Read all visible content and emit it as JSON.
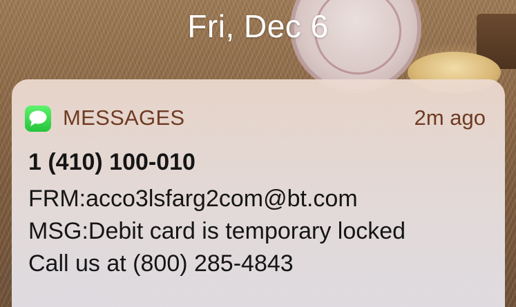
{
  "lock_screen": {
    "date": "Fri, Dec 6"
  },
  "notification": {
    "app_name": "MESSAGES",
    "app_icon": "messages-bubble-icon",
    "timestamp": "2m ago",
    "sender": "1 (410) 100-010",
    "body_lines": [
      "FRM:acco3lsfarg2com@bt.com",
      "MSG:Debit card is temporary locked",
      "Call us at (800) 285-4843"
    ]
  },
  "colors": {
    "app_icon_green": "#25c43a",
    "header_text": "#6f3a22",
    "body_text": "#151515",
    "date_text": "#ffffff"
  }
}
